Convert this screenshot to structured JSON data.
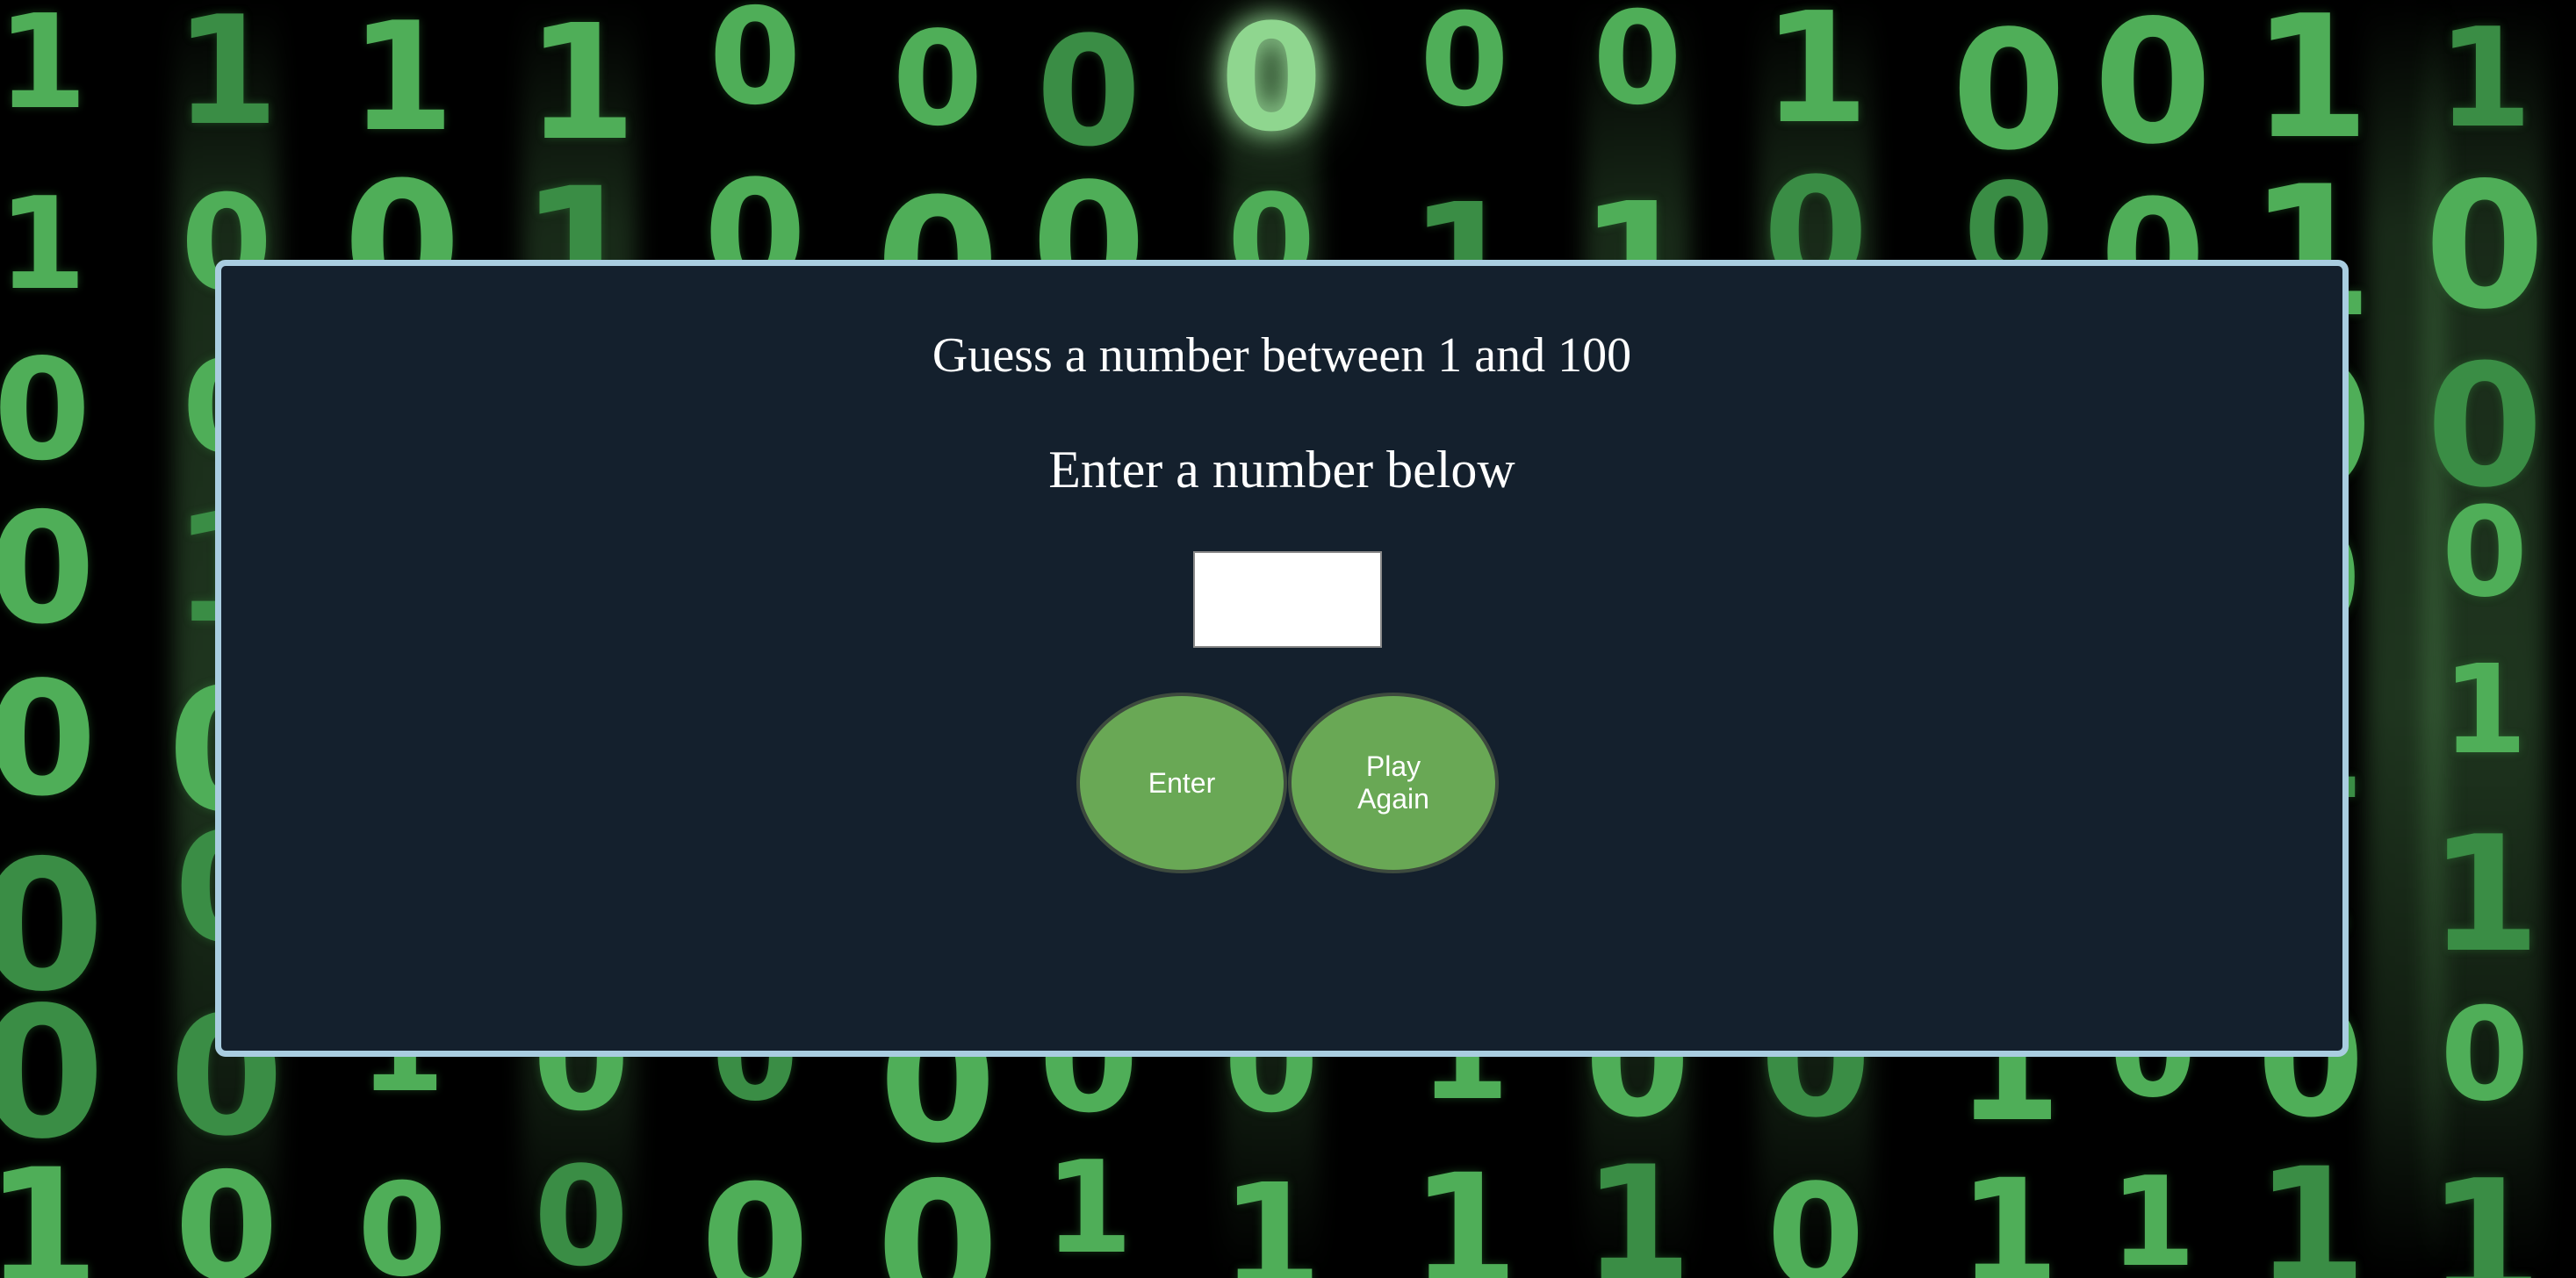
{
  "background": {
    "theme": "matrix-binary-rain",
    "digit_color": "#4fae58",
    "base_color": "#000000"
  },
  "game": {
    "title": "Guess a number between 1 and 100",
    "subtitle": "Enter a number below",
    "guess_input": {
      "value": "",
      "placeholder": ""
    },
    "enter_label": "Enter",
    "play_again_label": "Play Again",
    "panel_color": "#14202d",
    "panel_border_color": "#a9cde0",
    "button_color": "#69a855"
  }
}
